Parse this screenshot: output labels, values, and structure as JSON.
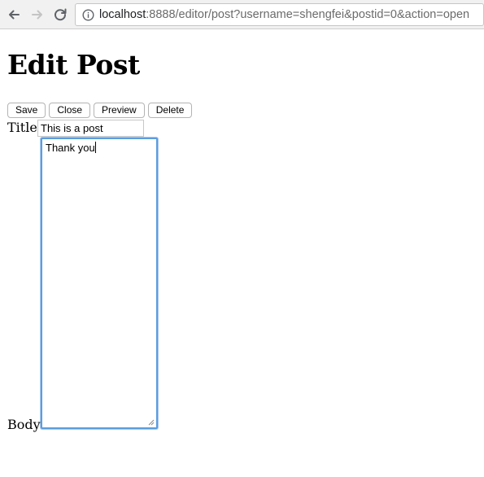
{
  "browser": {
    "address_host": "localhost",
    "address_rest": ":8888/editor/post?username=shengfei&postid=0&action=open",
    "icons": [
      "back-arrow-icon",
      "forward-arrow-icon",
      "reload-icon",
      "info-icon"
    ]
  },
  "page": {
    "heading": "Edit Post",
    "buttons": {
      "save": "Save",
      "close": "Close",
      "preview": "Preview",
      "delete": "Delete"
    },
    "title_label": "Title",
    "title_value": "This is a post",
    "body_label": "Body",
    "body_value": "Thank you"
  },
  "colors": {
    "focus_ring": "#5b9dde",
    "toolbar_bg": "#f1f1f1"
  }
}
